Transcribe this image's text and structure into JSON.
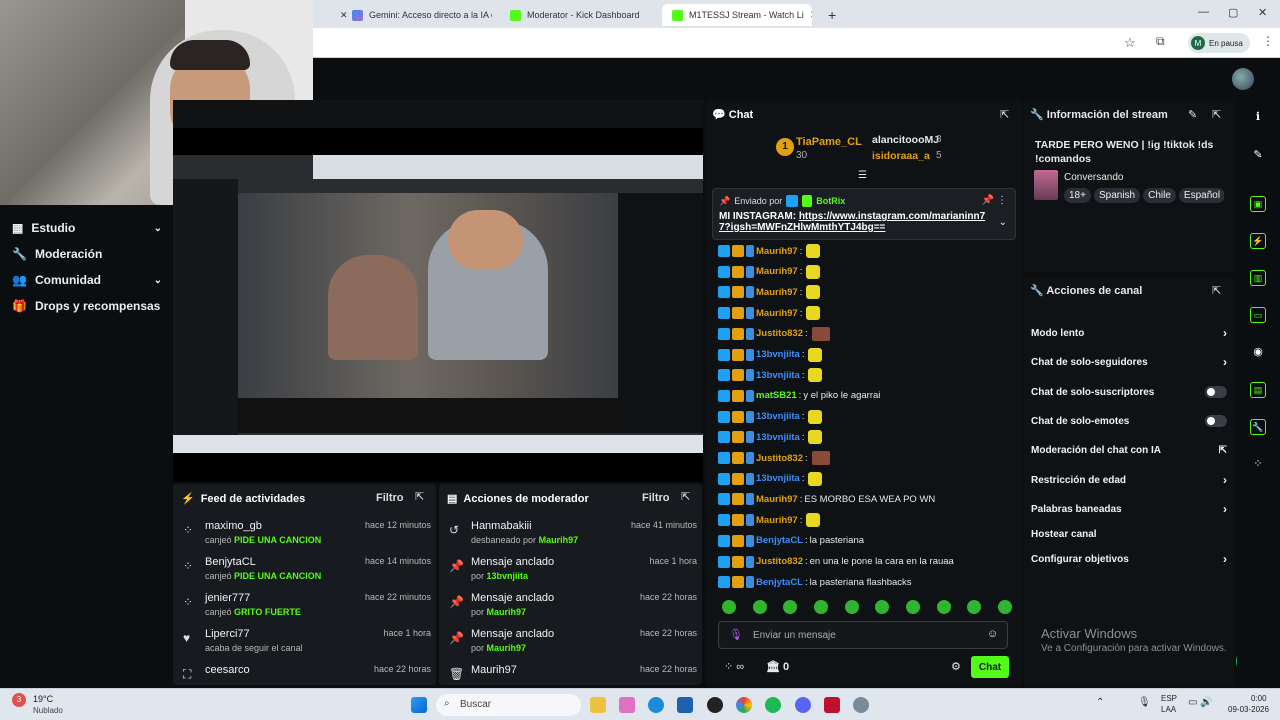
{
  "browser": {
    "tabs": [
      {
        "label": "Gemini: Acceso directo a la IA d"
      },
      {
        "label": "Moderator - Kick Dashboard"
      },
      {
        "label": "M1TESSJ Stream - Watch Li"
      }
    ],
    "new_tab": "+",
    "profile_initial": "M",
    "profile_status": "En pausa",
    "window": {
      "min": "—",
      "max": "▢",
      "close": "✕"
    }
  },
  "sidebar": {
    "items": [
      {
        "label": "Estudio"
      },
      {
        "label": "Moderación"
      },
      {
        "label": "Comunidad"
      },
      {
        "label": "Drops y recompensas"
      }
    ]
  },
  "activity_feed": {
    "title": "Feed de actividades",
    "filter": "Filtro",
    "rows": [
      {
        "name": "maximo_gb",
        "action": "canjeó",
        "highlight": "PIDE UNA CANCION",
        "time": "hace 12 minutos"
      },
      {
        "name": "BenjytaCL",
        "action": "canjeó",
        "highlight": "PIDE UNA CANCION",
        "time": "hace 14 minutos"
      },
      {
        "name": "jenier777",
        "action": "canjeó",
        "highlight": "GRITO FUERTE",
        "time": "hace 22 minutos"
      },
      {
        "name": "Liperci77",
        "action": "acaba de seguir el canal",
        "highlight": "",
        "time": "hace 1 hora"
      },
      {
        "name": "ceesarco",
        "action": "",
        "highlight": "",
        "time": "hace 22 horas"
      }
    ]
  },
  "mod_actions": {
    "title": "Acciones de moderador",
    "filter": "Filtro",
    "rows": [
      {
        "name": "Hanmabakiii",
        "sub": "desbaneado por",
        "by": "Maurih97",
        "time": "hace 41 minutos"
      },
      {
        "name": "Mensaje anclado",
        "sub": "por",
        "by": "13bvnjiita",
        "time": "hace 1 hora"
      },
      {
        "name": "Mensaje anclado",
        "sub": "por",
        "by": "Maurih97",
        "time": "hace 22 horas"
      },
      {
        "name": "Mensaje anclado",
        "sub": "por",
        "by": "Maurih97",
        "time": "hace 22 horas"
      },
      {
        "name": "Maurih97",
        "sub": "",
        "by": "",
        "time": "hace 22 horas"
      }
    ]
  },
  "chat": {
    "title": "Chat",
    "gifters": [
      {
        "name": "TiaPame_CL",
        "count": "30",
        "rank": "1"
      },
      {
        "name": "alancitoooMJ",
        "count": "8"
      },
      {
        "name": "isidoraaa_a",
        "count": "5"
      }
    ],
    "pinned": {
      "sent_by_label": "Enviado por",
      "sender": "BotRix",
      "text": "MI INSTAGRAM: ",
      "link": "https://www.instagram.com/marianinn77?igsh=MWFnZHlwMmthYTJ4bg=="
    },
    "messages": [
      {
        "user": "Mauríh97",
        "text": "",
        "cls": "u-gold",
        "emote": true
      },
      {
        "user": "Mauríh97",
        "text": "",
        "cls": "u-gold",
        "emote": true
      },
      {
        "user": "Mauríh97",
        "text": "",
        "cls": "u-gold",
        "emote": true
      },
      {
        "user": "Mauríh97",
        "text": "",
        "cls": "u-gold",
        "emote": true
      },
      {
        "user": "Justito832",
        "text": "",
        "cls": "u-gold",
        "emote2": true
      },
      {
        "user": "13bvnjiita",
        "text": "",
        "cls": "u-blue",
        "emote": true
      },
      {
        "user": "13bvnjiita",
        "text": "",
        "cls": "u-blue",
        "emote": true
      },
      {
        "user": "matSB21",
        "text": "y el piko le agarrai",
        "cls": "u-grn"
      },
      {
        "user": "13bvnjiita",
        "text": "",
        "cls": "u-blue",
        "emote": true
      },
      {
        "user": "13bvnjiita",
        "text": "",
        "cls": "u-blue",
        "emote": true
      },
      {
        "user": "Justito832",
        "text": "",
        "cls": "u-gold",
        "emote2": true
      },
      {
        "user": "13bvnjiita",
        "text": "",
        "cls": "u-blue",
        "emote": true
      },
      {
        "user": "Maurih97",
        "text": "ES MORBO ESA WEA PO WN",
        "cls": "u-gold"
      },
      {
        "user": "Maurih97",
        "text": "",
        "cls": "u-gold",
        "emote": true
      },
      {
        "user": "BenjytaCL",
        "text": "la pasteriana",
        "cls": "u-blue"
      },
      {
        "user": "Justito832",
        "text": "en una le pone la cara en la rauaa",
        "cls": "u-gold"
      },
      {
        "user": "BenjytaCL",
        "text": "la pasteriana flashbacks",
        "cls": "u-blue"
      }
    ],
    "input_placeholder": "Enviar un mensaje",
    "points": "0",
    "send": "Chat"
  },
  "stream_info": {
    "title": "Información del stream",
    "stream_title": "TARDE PERO WENO | !ig !tiktok !ds !comandos",
    "category": "Conversando",
    "tags": [
      "18+",
      "Spanish",
      "Chile",
      "Español"
    ]
  },
  "channel_actions": {
    "title": "Acciones de canal",
    "items": [
      {
        "label": "Modo lento",
        "kind": "chevron"
      },
      {
        "label": "Chat de solo-seguidores",
        "kind": "chevron"
      },
      {
        "label": "Chat de solo-suscriptores",
        "kind": "toggle"
      },
      {
        "label": "Chat de solo-emotes",
        "kind": "toggle"
      },
      {
        "label": "Moderación del chat con IA",
        "kind": "link"
      },
      {
        "label": "Restricción de edad",
        "kind": "chevron"
      },
      {
        "label": "Palabras baneadas",
        "kind": "chevron"
      },
      {
        "label": "Hostear canal",
        "kind": "none"
      },
      {
        "label": "Configurar objetivos",
        "kind": "chevron"
      }
    ]
  },
  "watermark": {
    "title": "Activar Windows",
    "sub": "Ve a Configuración para activar Windows."
  },
  "taskbar": {
    "weather_temp": "19°C",
    "weather_desc": "Nublado",
    "search": "Buscar",
    "lang": "ESP",
    "lang2": "LAA",
    "time": "0:00",
    "date": "09-03-2026",
    "notif": "3"
  },
  "colors": {
    "accent": "#53fc18",
    "bg": "#0b0d0f",
    "panel": "#171a1e"
  }
}
